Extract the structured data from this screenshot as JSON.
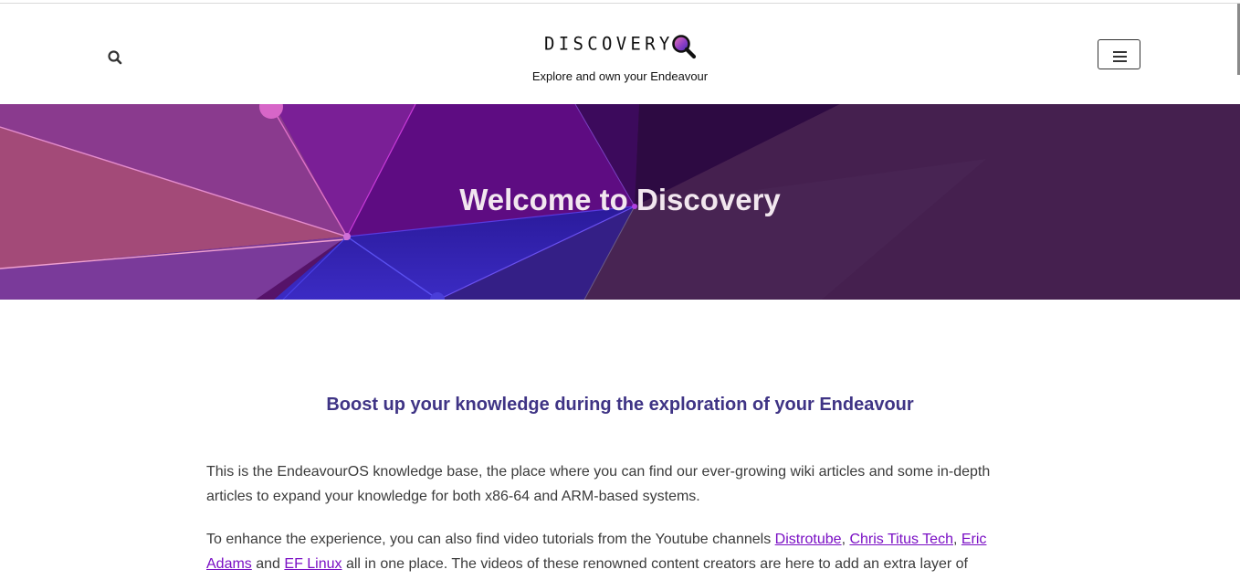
{
  "header": {
    "logo_text": "DISCOVERY",
    "tagline": "Explore and own your Endeavour",
    "search_icon": "search-icon",
    "menu_icon": "hamburger-menu-icon"
  },
  "hero": {
    "title": "Welcome to Discovery"
  },
  "main": {
    "heading": "Boost up your knowledge during the exploration of your Endeavour",
    "paragraph1": "This is the EndeavourOS knowledge base, the place where you can find our ever-growing wiki articles and some in-depth articles to expand your knowledge for both x86-64 and ARM-based systems.",
    "paragraph2": {
      "intro": "To enhance the experience, you can also find video tutorials from the Youtube channels ",
      "link1": "Distrotube",
      "sep1": ", ",
      "link2": "Chris Titus Tech",
      "sep2": ", ",
      "link3": "Eric Adams",
      "sep3": " and ",
      "link4": "EF Linux",
      "outro": " all in one place. The videos of these renowned content creators are here to add an extra layer of"
    }
  },
  "colors": {
    "heading": "#3f3485",
    "link": "#7a0fc4",
    "hero_text": "#f2e7ef"
  }
}
